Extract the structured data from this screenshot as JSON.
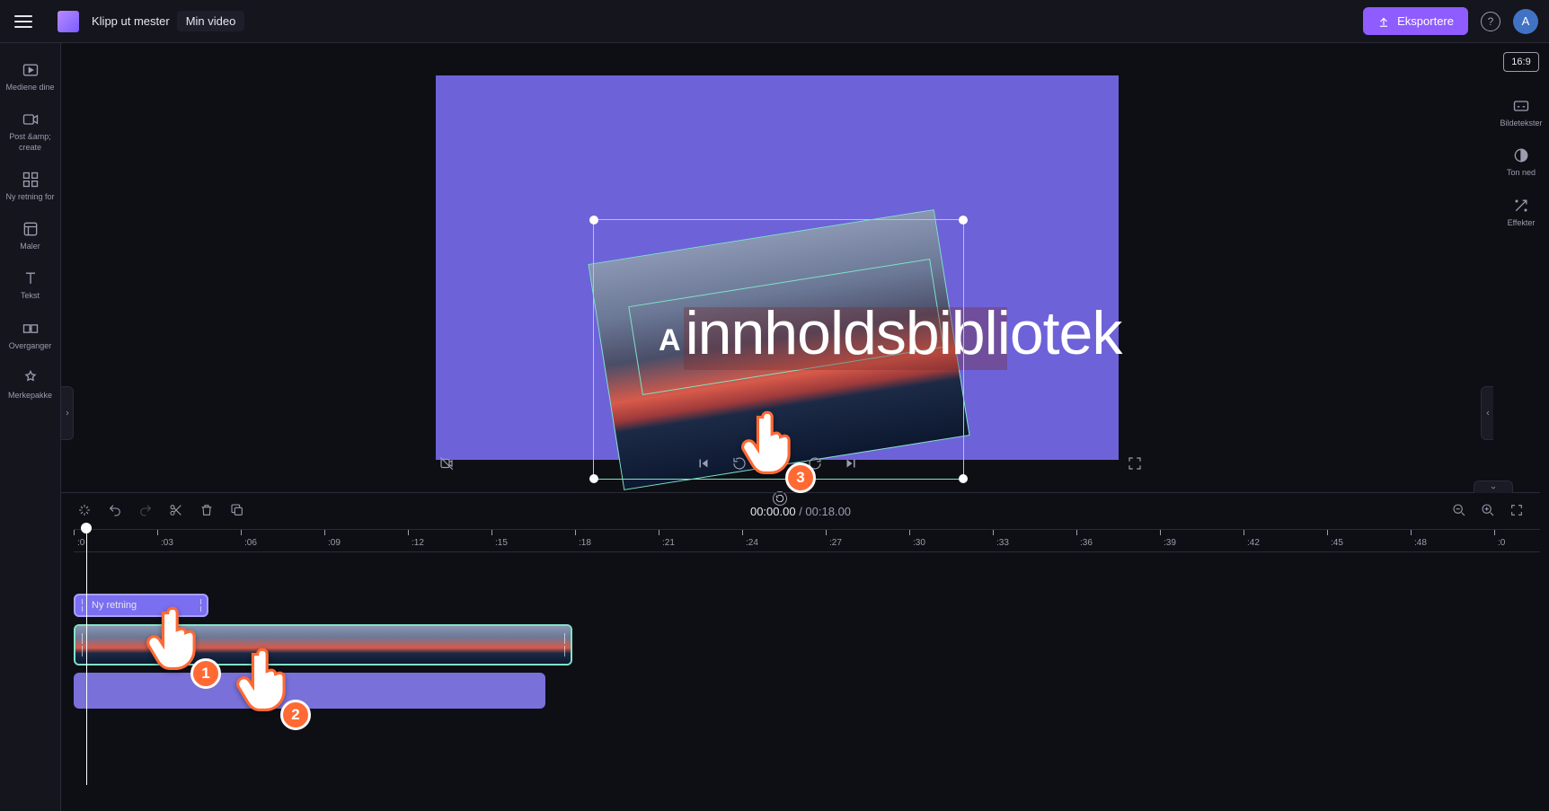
{
  "topbar": {
    "app_title": "Klipp ut mester",
    "video_name": "Min video",
    "export_label": "Eksportere",
    "avatar_initial": "A"
  },
  "left_sidebar": {
    "items": [
      {
        "id": "your-media",
        "label": "Mediene dine"
      },
      {
        "id": "record-create",
        "label": "Post &amp; create"
      },
      {
        "id": "content",
        "label": "Ny retning for"
      },
      {
        "id": "templates",
        "label": "Maler"
      },
      {
        "id": "text",
        "label": "Tekst"
      },
      {
        "id": "transitions",
        "label": "Overganger"
      },
      {
        "id": "brand-kit",
        "label": "Merkepakke"
      }
    ]
  },
  "right_sidebar": {
    "aspect_ratio": "16:9",
    "items": [
      {
        "id": "captions",
        "label": "Bildetekster"
      },
      {
        "id": "fade",
        "label": "Ton ned"
      },
      {
        "id": "effects",
        "label": "Effekter"
      }
    ]
  },
  "preview": {
    "overlay_text_prefix": "A",
    "overlay_text": "innholdsbibliotek"
  },
  "pointers": {
    "p1": "1",
    "p2": "2",
    "p3": "3"
  },
  "timeline": {
    "current_time": "00:00.00",
    "total_time": "00:18.00",
    "separator": " / ",
    "text_clip_label": "Ny retning",
    "ruler": [
      ":0",
      ":03",
      ":06",
      ":09",
      ":12",
      ":15",
      ":18",
      ":21",
      ":24",
      ":27",
      ":30",
      ":33",
      ":36",
      ":39",
      ":42",
      ":45",
      ":48",
      ":0"
    ]
  }
}
